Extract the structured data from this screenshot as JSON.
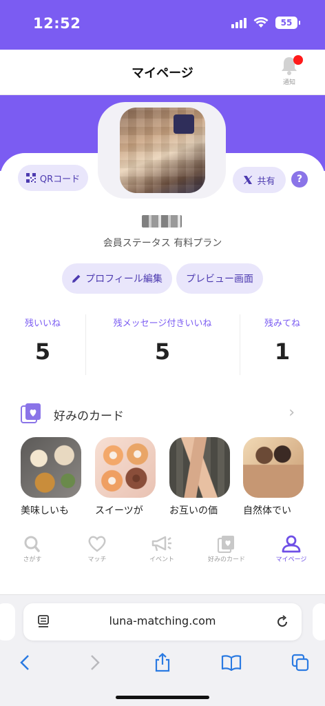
{
  "status_bar": {
    "time": "12:52",
    "battery": "55"
  },
  "header": {
    "title": "マイページ",
    "notification_label": "通知"
  },
  "profile": {
    "qr_label": "QRコード",
    "share_label": "共有",
    "help_label": "?",
    "member_status": "会員ステータス 有料プラン",
    "edit_label": "プロフィール編集",
    "preview_label": "プレビュー画面"
  },
  "stats": [
    {
      "label": "残いいね",
      "value": "5"
    },
    {
      "label": "残メッセージ付きいいね",
      "value": "5"
    },
    {
      "label": "残みてね",
      "value": "1"
    }
  ],
  "preferences": {
    "title": "好みのカード",
    "items": [
      {
        "label": "美味しいも"
      },
      {
        "label": "スイーツが"
      },
      {
        "label": "お互いの価"
      },
      {
        "label": "自然体でい"
      }
    ]
  },
  "tabs": [
    {
      "label": "さがす",
      "icon": "search-icon"
    },
    {
      "label": "マッチ",
      "icon": "heart-icon"
    },
    {
      "label": "イベント",
      "icon": "megaphone-icon"
    },
    {
      "label": "好みのカード",
      "icon": "cards-icon"
    },
    {
      "label": "マイページ",
      "icon": "person-icon"
    }
  ],
  "browser": {
    "url": "luna-matching.com"
  },
  "colors": {
    "accent": "#7b5cf2",
    "accent_light": "#e9e6fb",
    "badge_red": "#ff1a1a"
  }
}
